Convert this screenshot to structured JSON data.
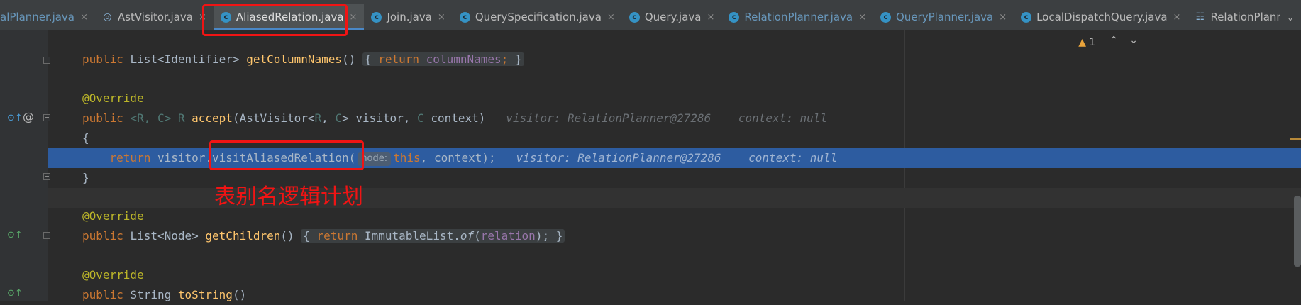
{
  "tabs": [
    {
      "label": "alPlanner.java",
      "icon": "class-icon",
      "modified": true,
      "active": false
    },
    {
      "label": "AstVisitor.java",
      "icon": "structure-class-icon",
      "modified": false,
      "active": false
    },
    {
      "label": "AliasedRelation.java",
      "icon": "class-icon",
      "modified": false,
      "active": true
    },
    {
      "label": "Join.java",
      "icon": "class-icon",
      "modified": false,
      "active": false
    },
    {
      "label": "QuerySpecification.java",
      "icon": "class-icon",
      "modified": false,
      "active": false
    },
    {
      "label": "Query.java",
      "icon": "class-icon",
      "modified": false,
      "active": false
    },
    {
      "label": "RelationPlanner.java",
      "icon": "class-icon",
      "modified": true,
      "active": false
    },
    {
      "label": "QueryPlanner.java",
      "icon": "class-icon",
      "modified": true,
      "active": false
    },
    {
      "label": "LocalDispatchQuery.java",
      "icon": "class-icon",
      "modified": false,
      "active": false
    },
    {
      "label": "RelationPlanner",
      "icon": "structure-icon",
      "modified": false,
      "active": false
    }
  ],
  "tab_close_glyph": "×",
  "tab_icon_letter": "c",
  "overflow_glyph": "⌄",
  "warnings": {
    "count": "1",
    "icon": "warning-triangle-icon"
  },
  "code": {
    "line1": {
      "kw": "public",
      "type": "List<Identifier>",
      "name": "getColumnNames",
      "sig": "()",
      "body_kw": "return",
      "field": "columnNames",
      "semi": ";"
    },
    "line2": {
      "ann": "@Override"
    },
    "line3": {
      "kw": "public",
      "gen1": "<R, C> R",
      "name": "accept",
      "p1": "(AstVisitor<",
      "gR": "R",
      "comma": ", ",
      "gC": "C",
      "p2": "> visitor, ",
      "gC2": "C",
      "p3": " context)",
      "hint1": "visitor: RelationPlanner@27286",
      "hint2": "context: null"
    },
    "line4": {
      "text": "{"
    },
    "line5": {
      "kw": "return",
      "pre": " visitor.visitAliasedRelation(",
      "param_hint": "node:",
      "this_kw": "this",
      "post": ", context);",
      "hint1": "visitor: RelationPlanner@27286",
      "hint2": "context: null"
    },
    "line6": {
      "text": "}"
    },
    "line7": {
      "ann": "@Override"
    },
    "line8": {
      "kw": "public",
      "type": "List<Node>",
      "name": "getChildren",
      "sig": "()",
      "body_kw": "return",
      "call": "ImmutableList.",
      "method": "of",
      "arg_pre": "(",
      "field": "relation",
      "arg_post": ");"
    },
    "line9": {
      "ann": "@Override"
    },
    "line10": {
      "kw": "public",
      "type": "String",
      "name": "toString",
      "sig": "()"
    }
  },
  "annotation": "表别名逻辑计划",
  "colors": {
    "highlight_box": "#f01414",
    "exec_line": "#2d5ca0",
    "background": "#2b2b2b"
  }
}
